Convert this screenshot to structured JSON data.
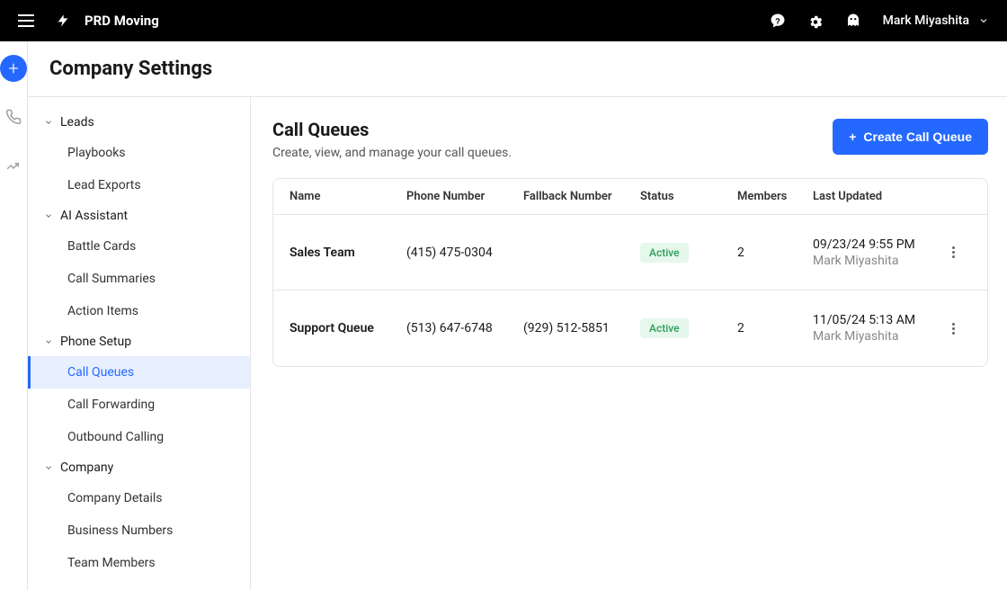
{
  "header": {
    "app_title": "PRD Moving",
    "user_name": "Mark Miyashita"
  },
  "page_title": "Company Settings",
  "sidebar": {
    "groups": [
      {
        "label": "Leads",
        "items": [
          {
            "label": "Playbooks",
            "active": false
          },
          {
            "label": "Lead Exports",
            "active": false
          }
        ]
      },
      {
        "label": "AI Assistant",
        "items": [
          {
            "label": "Battle Cards",
            "active": false
          },
          {
            "label": "Call Summaries",
            "active": false
          },
          {
            "label": "Action Items",
            "active": false
          }
        ]
      },
      {
        "label": "Phone Setup",
        "items": [
          {
            "label": "Call Queues",
            "active": true
          },
          {
            "label": "Call Forwarding",
            "active": false
          },
          {
            "label": "Outbound Calling",
            "active": false
          }
        ]
      },
      {
        "label": "Company",
        "items": [
          {
            "label": "Company Details",
            "active": false
          },
          {
            "label": "Business Numbers",
            "active": false
          },
          {
            "label": "Team Members",
            "active": false
          }
        ]
      }
    ]
  },
  "main": {
    "title": "Call Queues",
    "subtitle": "Create, view, and manage your call queues.",
    "create_label": "Create Call Queue",
    "columns": {
      "name": "Name",
      "phone": "Phone Number",
      "fallback": "Fallback Number",
      "status": "Status",
      "members": "Members",
      "updated": "Last Updated"
    },
    "rows": [
      {
        "name": "Sales Team",
        "phone": "(415) 475-0304",
        "fallback": "",
        "status": "Active",
        "members": "2",
        "updated_date": "09/23/24 9:55 PM",
        "updated_by": "Mark Miyashita"
      },
      {
        "name": "Support Queue",
        "phone": "(513) 647-6748",
        "fallback": "(929) 512-5851",
        "status": "Active",
        "members": "2",
        "updated_date": "11/05/24 5:13 AM",
        "updated_by": "Mark Miyashita"
      }
    ]
  }
}
